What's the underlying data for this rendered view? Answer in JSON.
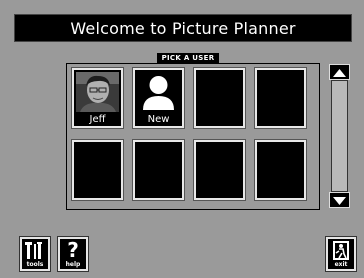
{
  "window": {
    "title": "Welcome to Picture Planner"
  },
  "picker": {
    "heading": "PICK A USER",
    "users": [
      {
        "name": "Jeff",
        "kind": "photo"
      },
      {
        "name": "New",
        "kind": "silhouette"
      }
    ]
  },
  "toolbar": {
    "tools_label": "tools",
    "help_label": "help",
    "exit_label": "exit"
  },
  "icons": {
    "scroll_up": "triangle-up-icon",
    "scroll_down": "triangle-down-icon",
    "tools": "tools-icon",
    "help": "question-mark-icon",
    "exit": "door-exit-icon"
  }
}
